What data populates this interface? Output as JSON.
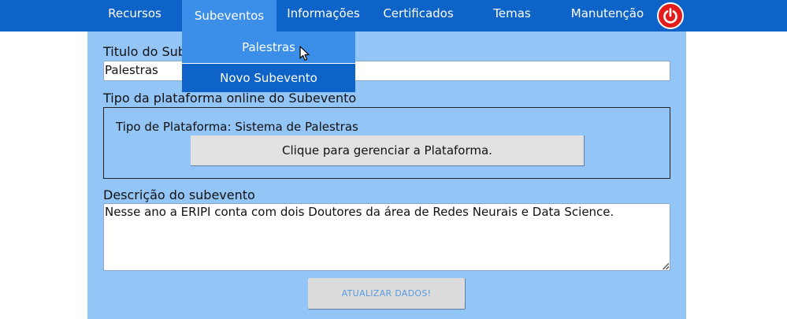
{
  "nav": {
    "items": [
      {
        "label": "Recursos"
      },
      {
        "label": "Subeventos"
      },
      {
        "label": "Informações"
      },
      {
        "label": "Certificados"
      },
      {
        "label": "Temas"
      },
      {
        "label": "Manutenção"
      }
    ],
    "active_index": 1,
    "power_icon": "power-icon",
    "colors": {
      "bar": "#0e63c8",
      "active": "#3c8fe8",
      "power": "#e21b1b"
    }
  },
  "dropdown": {
    "items": [
      {
        "label": "Palestras"
      },
      {
        "label": "Novo Subevento"
      }
    ],
    "hovered_index": 0
  },
  "form": {
    "title_label": "Titulo do Subevento",
    "title_value": "Palestras",
    "platform_label": "Tipo da plataforma online do Subevento",
    "platform_type_text": "Tipo de Plataforma: Sistema de Palestras",
    "manage_button": "Clique para gerenciar a Plataforma.",
    "description_label": "Descrição do subevento",
    "description_value": "Nesse ano a ERIPI conta com dois Doutores da área de Redes Neurais e Data Science.",
    "update_button": "ATUALIZAR DADOS!",
    "panel_color": "#93c5f6"
  }
}
